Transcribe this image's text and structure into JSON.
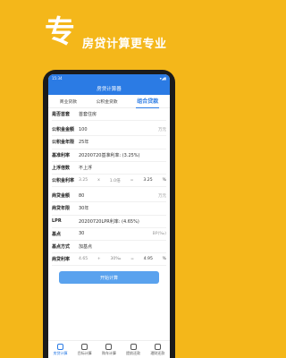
{
  "banner": {
    "big_char": "专",
    "slogan": "房贷计算更专业"
  },
  "status_bar": {
    "time": "15:34",
    "icons": "▾◢▮"
  },
  "header": {
    "title": "房贷计算器"
  },
  "tabs": [
    {
      "label": "商业贷款",
      "active": false
    },
    {
      "label": "公积金贷款",
      "active": false
    },
    {
      "label": "组合贷款",
      "active": true
    }
  ],
  "form": {
    "first_home": {
      "label": "是否首套",
      "value": "首套住房"
    },
    "fund_amount": {
      "label": "公积金金额",
      "value": "100",
      "unit": "万元"
    },
    "fund_years": {
      "label": "公积金年限",
      "value": "25年"
    },
    "base_rate": {
      "label": "基准利率",
      "value": "20200720基准利率: (3.25%)"
    },
    "float_multiple": {
      "label": "上浮倍数",
      "value": "不上浮"
    },
    "fund_rate": {
      "label": "公积金利率",
      "base": "3.25",
      "op": "x",
      "mult": "1.0倍",
      "eq": "=",
      "result": "3.25",
      "pct": "%"
    },
    "biz_amount": {
      "label": "商贷金额",
      "value": "80",
      "unit": "万元"
    },
    "biz_years": {
      "label": "商贷年限",
      "value": "30年"
    },
    "lpr": {
      "label": "LPR",
      "value": "20200720LPR利率: (4.65%)"
    },
    "basis_points": {
      "label": "基点",
      "value": "30",
      "unit": "BP(‰)"
    },
    "basis_method": {
      "label": "基点方式",
      "value": "加基点"
    },
    "biz_rate": {
      "label": "商贷利率",
      "base": "4.65",
      "op": "+",
      "bp": "30‰",
      "eq": "=",
      "result": "4.95",
      "pct": "%"
    }
  },
  "submit_label": "开始计算",
  "bottom_nav": [
    {
      "label": "房贷计算",
      "active": true
    },
    {
      "label": "目标计算",
      "active": false
    },
    {
      "label": "购车计算",
      "active": false
    },
    {
      "label": "提前还款",
      "active": false
    },
    {
      "label": "理财还款",
      "active": false
    }
  ]
}
